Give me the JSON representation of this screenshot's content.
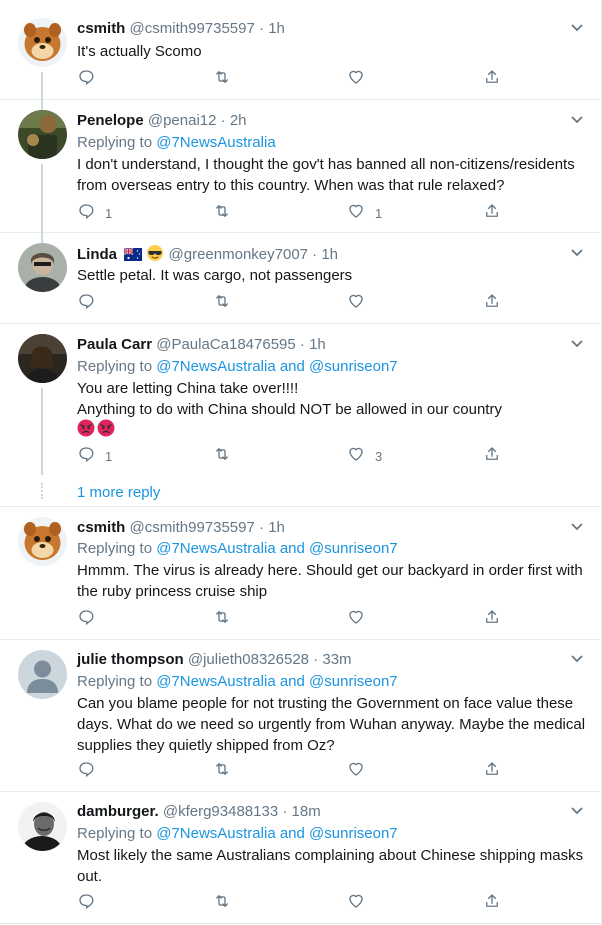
{
  "tweets": [
    {
      "name": "csmith",
      "handle": "@csmith99735597",
      "time": "1h",
      "replying_prefix": "",
      "replying_to": [],
      "body": [
        "It's actually Scomo"
      ],
      "reply_count": "",
      "retweet_count": "",
      "like_count": ""
    },
    {
      "name": "Penelope",
      "handle": "@penai12",
      "time": "2h",
      "replying_prefix": "Replying to",
      "replying_to": [
        "@7NewsAustralia"
      ],
      "body": [
        "I don't understand, I thought the gov't has banned all non-citizens/residents",
        "from overseas entry to this country. When was that rule relaxed?"
      ],
      "reply_count": "1",
      "retweet_count": "",
      "like_count": "1"
    },
    {
      "name": "Linda",
      "handle": "@greenmonkey7007",
      "time": "1h",
      "replying_prefix": "",
      "replying_to": [],
      "body": [
        "Settle petal. It was cargo, not passengers"
      ],
      "reply_count": "",
      "retweet_count": "",
      "like_count": ""
    },
    {
      "name": "Paula Carr",
      "handle": "@PaulaCa18476595",
      "time": "1h",
      "replying_prefix": "Replying to",
      "replying_to": [
        "@7NewsAustralia",
        "and",
        "@sunriseon7"
      ],
      "body": [
        "You are letting China take over!!!!",
        "Anything to do with China  should NOT be allowed in our country"
      ],
      "reply_count": "1",
      "retweet_count": "",
      "like_count": "3"
    },
    {
      "name": "csmith",
      "handle": "@csmith99735597",
      "time": "1h",
      "replying_prefix": "Replying to",
      "replying_to": [
        "@7NewsAustralia",
        "and",
        "@sunriseon7"
      ],
      "body": [
        "Hmmm. The virus is already here. Should get our backyard in order first with",
        "the ruby princess cruise ship"
      ],
      "reply_count": "",
      "retweet_count": "",
      "like_count": ""
    },
    {
      "name": "julie thompson",
      "handle": "@julieth08326528",
      "time": "33m",
      "replying_prefix": "Replying to",
      "replying_to": [
        "@7NewsAustralia",
        "and",
        "@sunriseon7"
      ],
      "body": [
        "Can you blame people for not trusting the Government on face value these",
        "days. What do we need so urgently from Wuhan anyway. Maybe the medical",
        "supplies they quietly shipped from Oz?"
      ],
      "reply_count": "",
      "retweet_count": "",
      "like_count": ""
    },
    {
      "name": "damburger.",
      "handle": "@kferg93488133",
      "time": "18m",
      "replying_prefix": "Replying to",
      "replying_to": [
        "@7NewsAustralia",
        "and",
        "@sunriseon7"
      ],
      "body": [
        "Most likely the same Australians complaining about Chinese shipping masks",
        "out."
      ],
      "reply_count": "",
      "retweet_count": "",
      "like_count": ""
    }
  ],
  "more_replies_label": "1 more reply",
  "separator": "·",
  "colors": {
    "accent": "#1b95e0",
    "secondary_text": "#657786",
    "border": "#e6ecf0",
    "angry_emoji": "#e0245e"
  }
}
